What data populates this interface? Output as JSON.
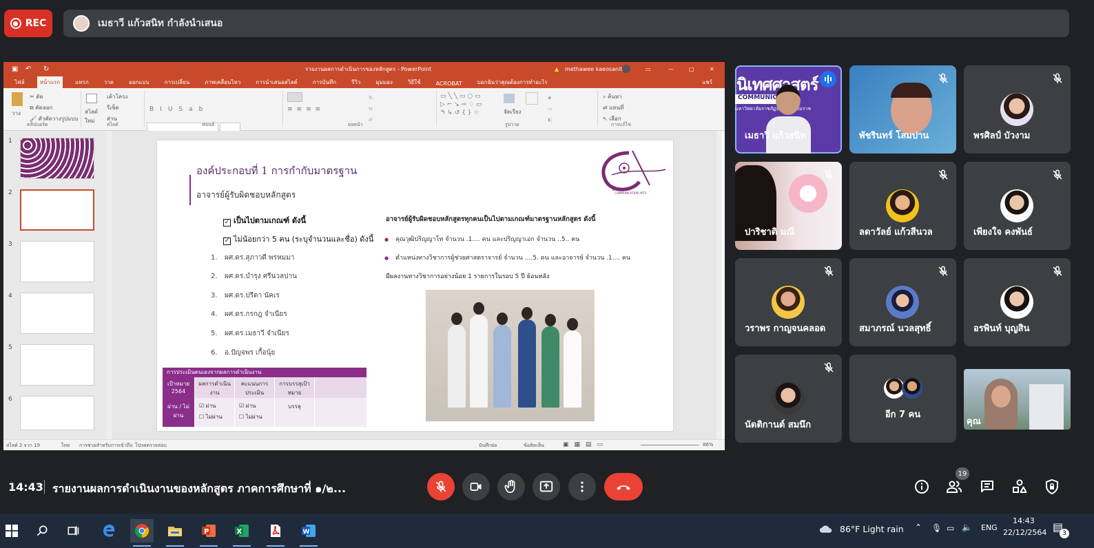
{
  "rec_label": "REC",
  "presenter_text": "เมธาวี แก้วสนิท กำลังนำเสนอ",
  "powerpoint": {
    "title": "รายงานผลการดำเนินการของหลักสูตร - PowerPoint",
    "user": "methawee kaeosanit",
    "tabs": [
      "ไฟล์",
      "หน้าแรก",
      "แทรก",
      "วาด",
      "ออกแบบ",
      "การเปลี่ยน",
      "ภาพเคลื่อนไหว",
      "การนำเสนอสไลด์",
      "การบันทึก",
      "รีวิว",
      "มุมมอง",
      "วิธีใช้",
      "ACROBAT",
      "บอกฉันว่าคุณต้องการทำอะไร"
    ],
    "share_label": "แชร์",
    "ribbon_groups": [
      "คลิปบอร์ด",
      "สไลด์",
      "ฟอนต์",
      "ย่อหน้า",
      "รูปวาด",
      "การแก้ไข"
    ],
    "ribbon_buttons": {
      "paste": "วาง",
      "cut": "ตัด",
      "copy": "คัดลอก",
      "format_painter": "ตัวคัดวางรูปแบบ",
      "new_slide": "สไลด์ใหม่",
      "layout": "เค้าโครง",
      "reset": "รีเซ็ต",
      "section": "ส่วน",
      "arrange": "จัดเรียง",
      "find": "ค้นหา",
      "replace": "แทนที่",
      "select": "เลือก"
    },
    "slide_numbers": [
      "1",
      "2",
      "3",
      "4",
      "5",
      "6"
    ],
    "status_left": "สไลด์ 2 จาก 19",
    "status_lang": "ไทย",
    "status_access": "การช่วยสำหรับการเข้าถึง: โปรดตรวจสอบ",
    "status_notes": "บันทึกย่อ",
    "status_comments": "ข้อคิดเห็น",
    "zoom": "86%"
  },
  "slide": {
    "title": "องค์ประกอบที่ 1 การกำกับมาตรฐาน",
    "subtitle": "อาจารย์ผู้รับผิดชอบหลักสูตร",
    "check1": "เป็นไปตามเกณฑ์ ดังนี้",
    "check2": "ไม่น้อยกว่า 5 คน (ระบุจำนวนและชื่อ)  ดังนี้",
    "list": [
      {
        "n": "1.",
        "t": "ผศ.ดร.สุภาวดี พรหมมา"
      },
      {
        "n": "2.",
        "t": "ผศ.ดร.บำรุง ศรีนวลปาน"
      },
      {
        "n": "3.",
        "t": "ผศ.ดร.ปรีดา นัคเร"
      },
      {
        "n": "4.",
        "t": "ผศ.ดร.กรกฎ จำเนียร"
      },
      {
        "n": "5.",
        "t": "ผศ.ดร.เมธาวี จำเนียร"
      },
      {
        "n": "6.",
        "t": "อ.ปัญจพร เกื้อนุ้ย"
      }
    ],
    "right_heading": "อาจารย์ผู้รับผิดชอบหลักสูตรทุกคนเป็นไปตามเกณฑ์มาตรฐานหลักสูตร ดังนี้",
    "bullet1": "คุณวุฒิปริญญาโท จำนวน .1.... คน และปริญญาเอก จำนวน ..5.. คน",
    "bullet2": "ตำแหน่งทางวิชาการผู้ช่วยศาสตราจารย์ จำนวน ....5. คน และอาจารย์ จำนวน .1.... คน",
    "bullet2_cont": "มีผลงานทางวิชาการอย่างน้อย 1 รายการในรอบ 5 ปี ย้อนหลัง",
    "logo_text": "นิเทศศาสตร์",
    "logo_sub": "COMMUNICATION ARTS",
    "table": {
      "header": "การประเมินตนเองจากผลการดำเนินงาน",
      "cols": [
        "เป้าหมาย 2564",
        "ผลการดำเนินงาน",
        "คะแนนการประเมิน",
        "การบรรลุเป้าหมาย"
      ],
      "row_label": "ผ่าน / ไม่ผ่าน",
      "pass": "ผ่าน",
      "fail": "ไม่ผ่าน",
      "achieved": "บรรลุ"
    }
  },
  "participants": [
    {
      "name": "เมธาวี แก้วสนิท",
      "kind": "video-presenter"
    },
    {
      "name": "พัชรินทร์ โสมปาน",
      "kind": "video"
    },
    {
      "name": "พรศิลป์ บัวงาม",
      "kind": "avatar"
    },
    {
      "name": "ปาริชาติ มณี",
      "kind": "video"
    },
    {
      "name": "ลดาวัลย์ แก้วสีนวล",
      "kind": "avatar"
    },
    {
      "name": "เพียงใจ คงพันธ์",
      "kind": "avatar"
    },
    {
      "name": "วราพร กาญจนคลอด",
      "kind": "avatar"
    },
    {
      "name": "สมาภรณ์ นวลสุทธิ์",
      "kind": "avatar"
    },
    {
      "name": "อรพินท์ บุญสิน",
      "kind": "avatar"
    },
    {
      "name": "นัดติกานต์ สมนึก",
      "kind": "avatar"
    },
    {
      "name": "อีก 7 คน",
      "kind": "more"
    },
    {
      "name": "คุณ",
      "kind": "video-self"
    }
  ],
  "tile_overlay_text": "นิเทศศาสตร์",
  "tile_overlay_sub": "COMMUNICATION ARTS",
  "tile_overlay_sub2": "มหาวิทยาลัยราชภัฏนครศรีธรรมราช",
  "bottom": {
    "time": "14:43",
    "meeting_title": "รายงานผลการดำเนินงานของหลักสูตร ภาคการศึกษาที่ ๑/๒...",
    "participant_count": "19"
  },
  "taskbar": {
    "weather": "86°F  Light rain",
    "lang": "ENG",
    "time": "14:43",
    "date": "22/12/2564",
    "notifications": "3"
  },
  "colors": {
    "rec": "#d93025",
    "end_call": "#ea4335",
    "ppt_accent": "#c9492b",
    "slide_accent": "#8a2e8a",
    "meet_bg": "#202124",
    "tile_bg": "#3c4043"
  }
}
